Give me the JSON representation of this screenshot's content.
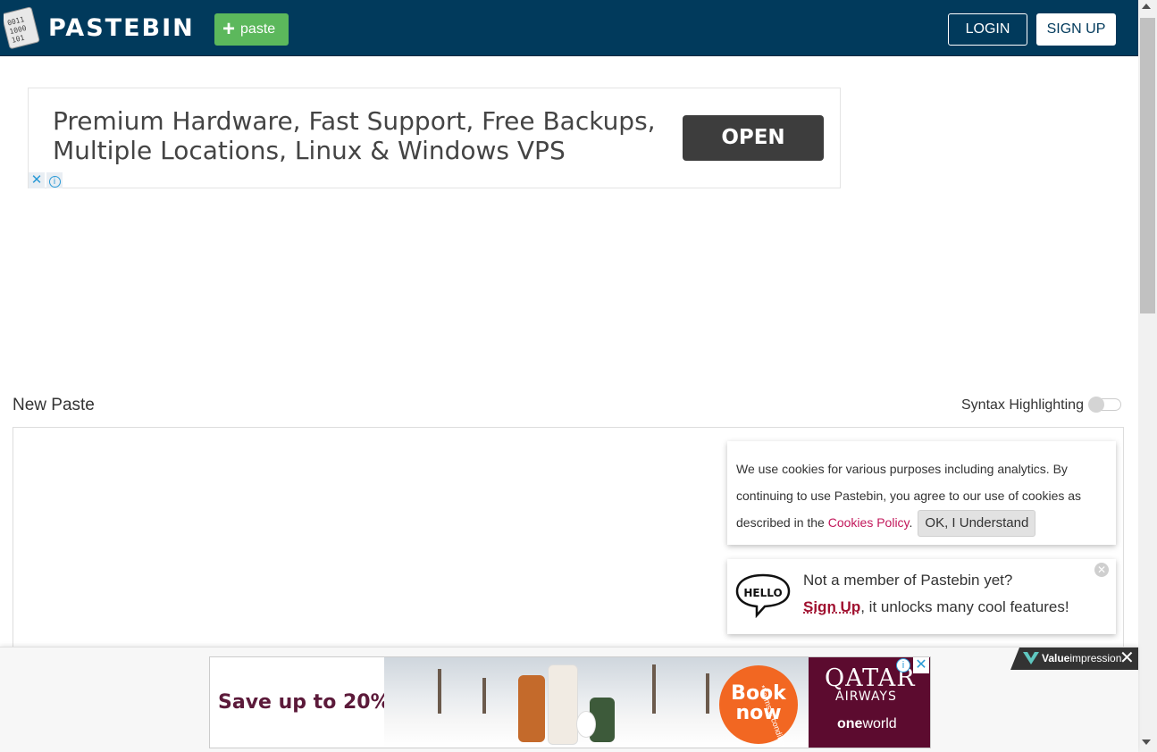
{
  "header": {
    "brand": "PASTEBIN",
    "paste_button": "paste",
    "login_button": "LOGIN",
    "signup_button": "SIGN UP"
  },
  "top_ad": {
    "headline": "Premium Hardware, Fast Support, Free Backups, Multiple Locations, Linux & Windows VPS",
    "cta": "OPEN",
    "close_glyph": "✕",
    "info_glyph": "i"
  },
  "editor": {
    "title": "New Paste",
    "syntax_label": "Syntax Highlighting",
    "syntax_enabled": false
  },
  "cookie_notice": {
    "text_before": "We use cookies for various purposes including analytics. By continuing to use Pastebin, you agree to our use of cookies as described in the ",
    "link": "Cookies Policy",
    "text_after": ".",
    "ok_button": "OK, I Understand"
  },
  "member_notice": {
    "icon_text": "HELLO",
    "line1": "Not a member of Pastebin yet?",
    "signup_link": "Sign Up",
    "line2_rest": ", it unlocks many cool features!",
    "close_glyph": "✕"
  },
  "bottom_ad": {
    "provider_bold": "Value",
    "provider_rest": "impression",
    "headline": "Save up to 20%",
    "book_line1": "Book",
    "book_line2": "now",
    "terms": "*Terms & conditions apply",
    "brand": "QATAR",
    "brand_sub": "AIRWAYS",
    "alliance_bold": "one",
    "alliance_rest": "world",
    "close_glyph": "✕",
    "info_glyph": "i"
  },
  "colors": {
    "header_bg": "#013a5c",
    "paste_button_bg": "#5cb85c",
    "cookie_link": "#c2185b",
    "signup_link": "#a0102f",
    "ad_maroon": "#5c0b2f",
    "book_orange": "#f26722"
  }
}
